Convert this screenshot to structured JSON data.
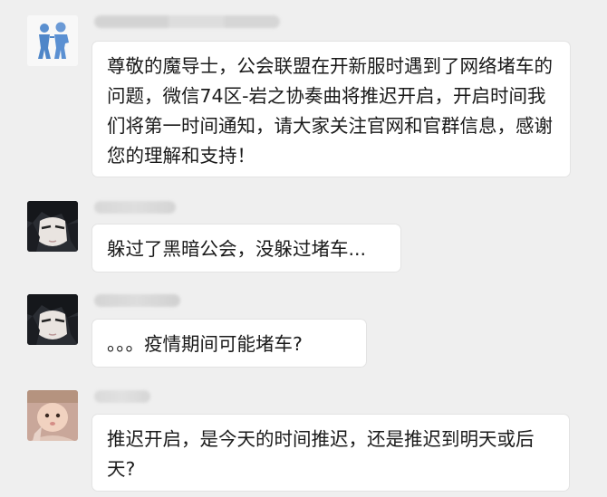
{
  "messages": [
    {
      "sender": "",
      "avatar": "couple-silhouette-avatar",
      "text": "尊敬的魔导士，公会联盟在开新服时遇到了网络堵车的问题，微信74区-岩之协奏曲将推迟开启，开启时间我们将第一时间通知，请大家关注官网和官群信息，感谢您的理解和支持！"
    },
    {
      "sender": "",
      "avatar": "anime-character-avatar",
      "text": "躲过了黑暗公会，没躲过堵车..."
    },
    {
      "sender": "",
      "avatar": "anime-character-avatar",
      "text": "。。。疫情期间可能堵车?"
    },
    {
      "sender": "",
      "avatar": "baby-photo-avatar",
      "text": "推迟开启，是今天的时间推迟，还是推迟到明天或后天?"
    }
  ],
  "colors": {
    "background": "#efefef",
    "bubble": "#ffffff",
    "bubble_border": "#e3e3e3",
    "text": "#1a1a1a"
  }
}
